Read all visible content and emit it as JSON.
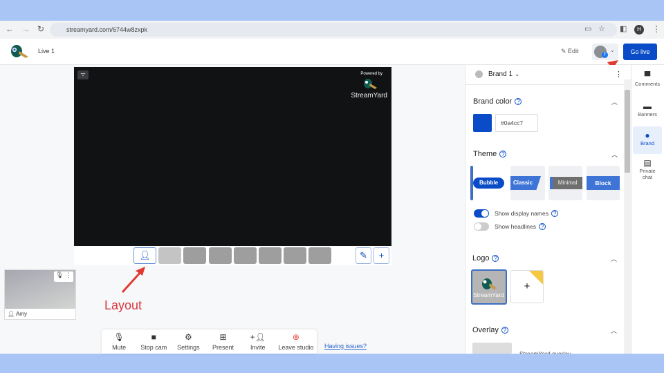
{
  "browser": {
    "url": "streamyard.com/6744w8zxpk",
    "profile_initial": "H"
  },
  "header": {
    "title": "Live 1",
    "edit_label": "Edit",
    "go_live_label": "Go live"
  },
  "stage": {
    "powered_by": "Powered by",
    "brand_name": "StreamYard"
  },
  "participants": [
    {
      "name": "Amy"
    }
  ],
  "annotation": {
    "layout_label": "Layout"
  },
  "toolbar": {
    "items": [
      "Mute",
      "Stop cam",
      "Settings",
      "Present",
      "Invite",
      "Leave studio"
    ],
    "help_link": "Having issues?"
  },
  "panel": {
    "brand_selector": "Brand 1",
    "brand_color": {
      "title": "Brand color",
      "value": "#0a4cc7"
    },
    "theme": {
      "title": "Theme",
      "options": [
        "Bubble",
        "Classic",
        "Minimal",
        "Block"
      ],
      "selected": "Bubble",
      "show_display_names": "Show display names",
      "show_headlines": "Show headlines"
    },
    "logo": {
      "title": "Logo",
      "add": "+"
    },
    "overlay": {
      "title": "Overlay",
      "first_item": "StreamYard overlay"
    }
  },
  "right_nav": {
    "items": [
      "Comments",
      "Banners",
      "Brand",
      "Private chat"
    ],
    "active": "Brand"
  },
  "colors": {
    "accent": "#0a4cc7",
    "annotation": "#d9363e"
  }
}
